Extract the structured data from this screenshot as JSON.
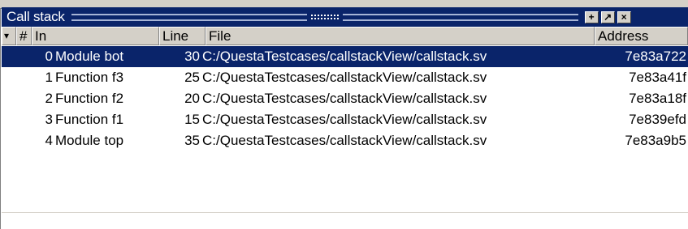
{
  "window": {
    "title": "Call stack",
    "buttons": [
      "+",
      "↗",
      "×"
    ]
  },
  "columns": [
    {
      "key": "dropdown",
      "label": "▾"
    },
    {
      "key": "num",
      "label": "#"
    },
    {
      "key": "in",
      "label": "In"
    },
    {
      "key": "line",
      "label": "Line"
    },
    {
      "key": "file",
      "label": "File"
    },
    {
      "key": "address",
      "label": "Address"
    }
  ],
  "rows": [
    {
      "num": "0",
      "in": "Module bot",
      "line": "30",
      "file": "C:/QuestaTestcases/callstackView/callstack.sv",
      "address": "7e83a722",
      "selected": true
    },
    {
      "num": "1",
      "in": "Function f3",
      "line": "25",
      "file": "C:/QuestaTestcases/callstackView/callstack.sv",
      "address": "7e83a41f",
      "selected": false
    },
    {
      "num": "2",
      "in": "Function f2",
      "line": "20",
      "file": "C:/QuestaTestcases/callstackView/callstack.sv",
      "address": "7e83a18f",
      "selected": false
    },
    {
      "num": "3",
      "in": "Function f1",
      "line": "15",
      "file": "C:/QuestaTestcases/callstackView/callstack.sv",
      "address": "7e839efd",
      "selected": false
    },
    {
      "num": "4",
      "in": "Module top",
      "line": "35",
      "file": "C:/QuestaTestcases/callstackView/callstack.sv",
      "address": "7e83a9b5",
      "selected": false
    }
  ],
  "colors": {
    "titlebar": "#0a246a",
    "selection": "#0a246a",
    "chrome": "#d4d0c8"
  }
}
